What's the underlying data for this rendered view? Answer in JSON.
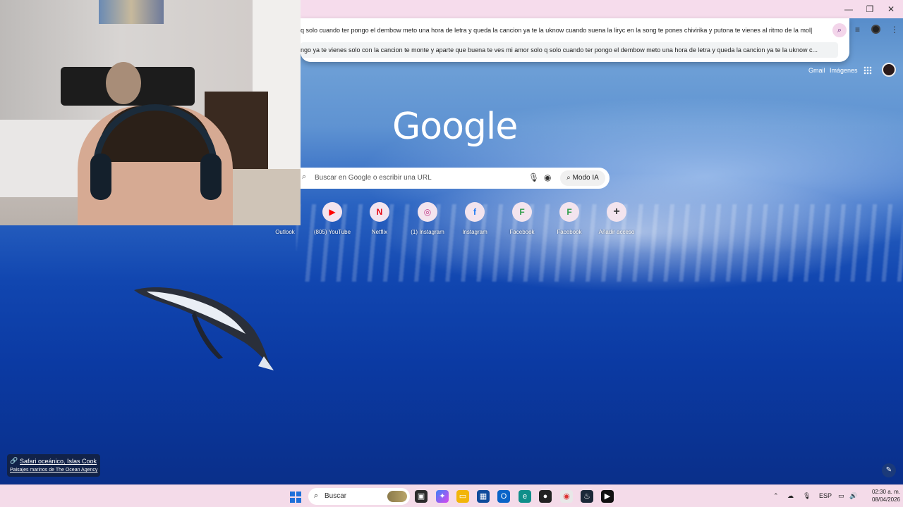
{
  "omnibox": {
    "query_text": "q solo cuando ter pongo el dembow meto una hora de letra y queda la cancion ya te la uknow cuando suena la liryc en la song te pones chivirika y putona te vienes al ritmo de la mol|",
    "suggestion_text": "ngo ya te vienes solo con la cancion te monte y aparte que buena te ves mi amor solo q solo cuando ter pongo el dembow meto una hora de letra y queda la cancion ya te la uknow c...",
    "lens_icon": "search-lens-icon"
  },
  "top_links": {
    "gmail": "Gmail",
    "images": "Imágenes"
  },
  "google_logo": "Google",
  "search": {
    "placeholder": "Buscar en Google o escribir una URL",
    "ai_mode_label": "Modo IA"
  },
  "shortcuts": [
    {
      "label": "Outlook",
      "icon": "outlook-icon",
      "glyph": ""
    },
    {
      "label": "(805) YouTube",
      "icon": "youtube-icon",
      "glyph": "▶"
    },
    {
      "label": "Netflix",
      "icon": "netflix-icon",
      "glyph": "N"
    },
    {
      "label": "(1) Instagram",
      "icon": "instagram-icon",
      "glyph": "◎"
    },
    {
      "label": "Instagram",
      "icon": "facebook-icon",
      "glyph": "f"
    },
    {
      "label": "Facebook",
      "icon": "f-letter-icon",
      "glyph": "F"
    },
    {
      "label": "Facebook",
      "icon": "f-letter-icon",
      "glyph": "F"
    },
    {
      "label": "Añadir acceso",
      "icon": "plus-icon",
      "glyph": "+"
    }
  ],
  "attribution": {
    "title": "Safari oceánico, Islas Cook",
    "subtitle": "Paisajes marinos de The Ocean Agency"
  },
  "taskbar": {
    "search_label": "Buscar",
    "language": "ESP",
    "time": "02:30 a. m.",
    "date": "08/04/2026"
  },
  "colors": {
    "accent": "#f6dcec",
    "taskbar": "#f4dbe9",
    "youtube": "#ff0000",
    "netflix": "#e50914",
    "facebook": "#1877f2",
    "f_green": "#2e9e4a"
  }
}
